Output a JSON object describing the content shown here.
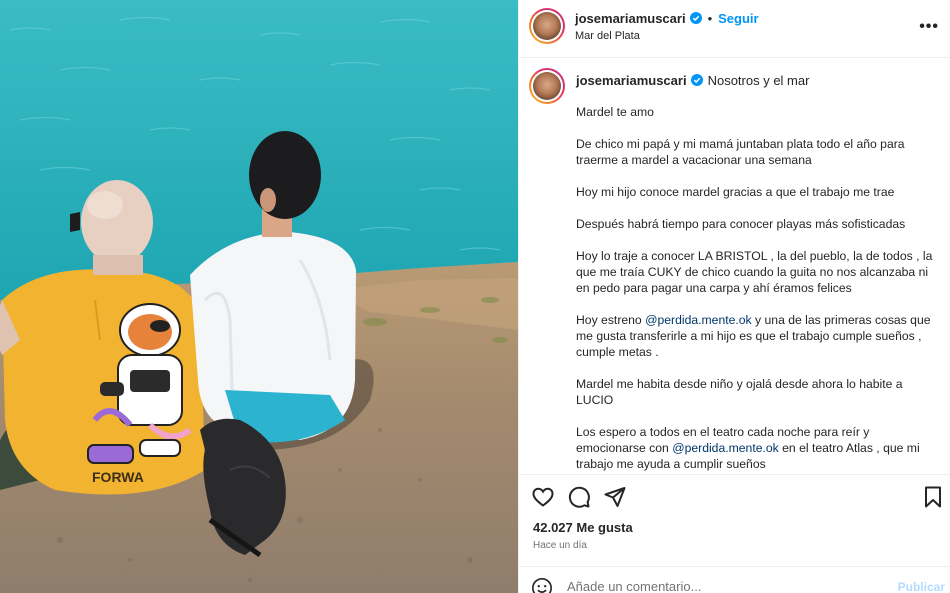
{
  "header": {
    "username": "josemariamuscari",
    "follow_label": "Seguir",
    "separator": "•",
    "location": "Mar del Plata",
    "more_label": "•••"
  },
  "caption": {
    "username": "josemariamuscari",
    "title": "Nosotros y el mar",
    "paragraphs": [
      {
        "text": "Mardel te amo"
      },
      {
        "text": "De chico mi papá y mi mamá juntaban plata todo el año para traerme a mardel a vacacionar una semana"
      },
      {
        "text": "Hoy mi hijo conoce mardel gracias a que el trabajo me trae"
      },
      {
        "text": "Después habrá tiempo para conocer playas más sofisticadas"
      },
      {
        "text": "Hoy lo traje a conocer LA BRISTOL , la del pueblo, la de todos , la que me traía CUKY de chico cuando la guita no nos alcanzaba ni en pedo para pagar una carpa y ahí éramos felices"
      },
      {
        "before": "Hoy estreno ",
        "mention": "@perdida.mente.ok",
        "after": " y una de las primeras cosas que me gusta transferirle a mi hijo es que el trabajo cumple sueños , cumple metas ."
      },
      {
        "text": "Mardel me habita desde niño y ojalá desde ahora lo habite a LUCIO"
      },
      {
        "before": "Los espero a todos en el teatro cada noche para reír y emocionarse con ",
        "mention": "@perdida.mente.ok",
        "after": " en el teatro Atlas , que mi trabajo me ayuda a cumplir sueños"
      }
    ]
  },
  "stats": {
    "likes": "42.027 Me gusta",
    "time": "Hace un día"
  },
  "comment": {
    "placeholder": "Añade un comentario...",
    "publish_label": "Publicar"
  },
  "icons": {
    "verified": "verified-badge-icon",
    "like": "heart-icon",
    "comment": "comment-bubble-icon",
    "share": "paper-plane-icon",
    "save": "bookmark-icon",
    "emoji": "smiley-icon"
  },
  "colors": {
    "accent": "#0095f6",
    "mention": "#00376b",
    "publish_disabled": "#b3dbff",
    "secondary_text": "#737373"
  }
}
